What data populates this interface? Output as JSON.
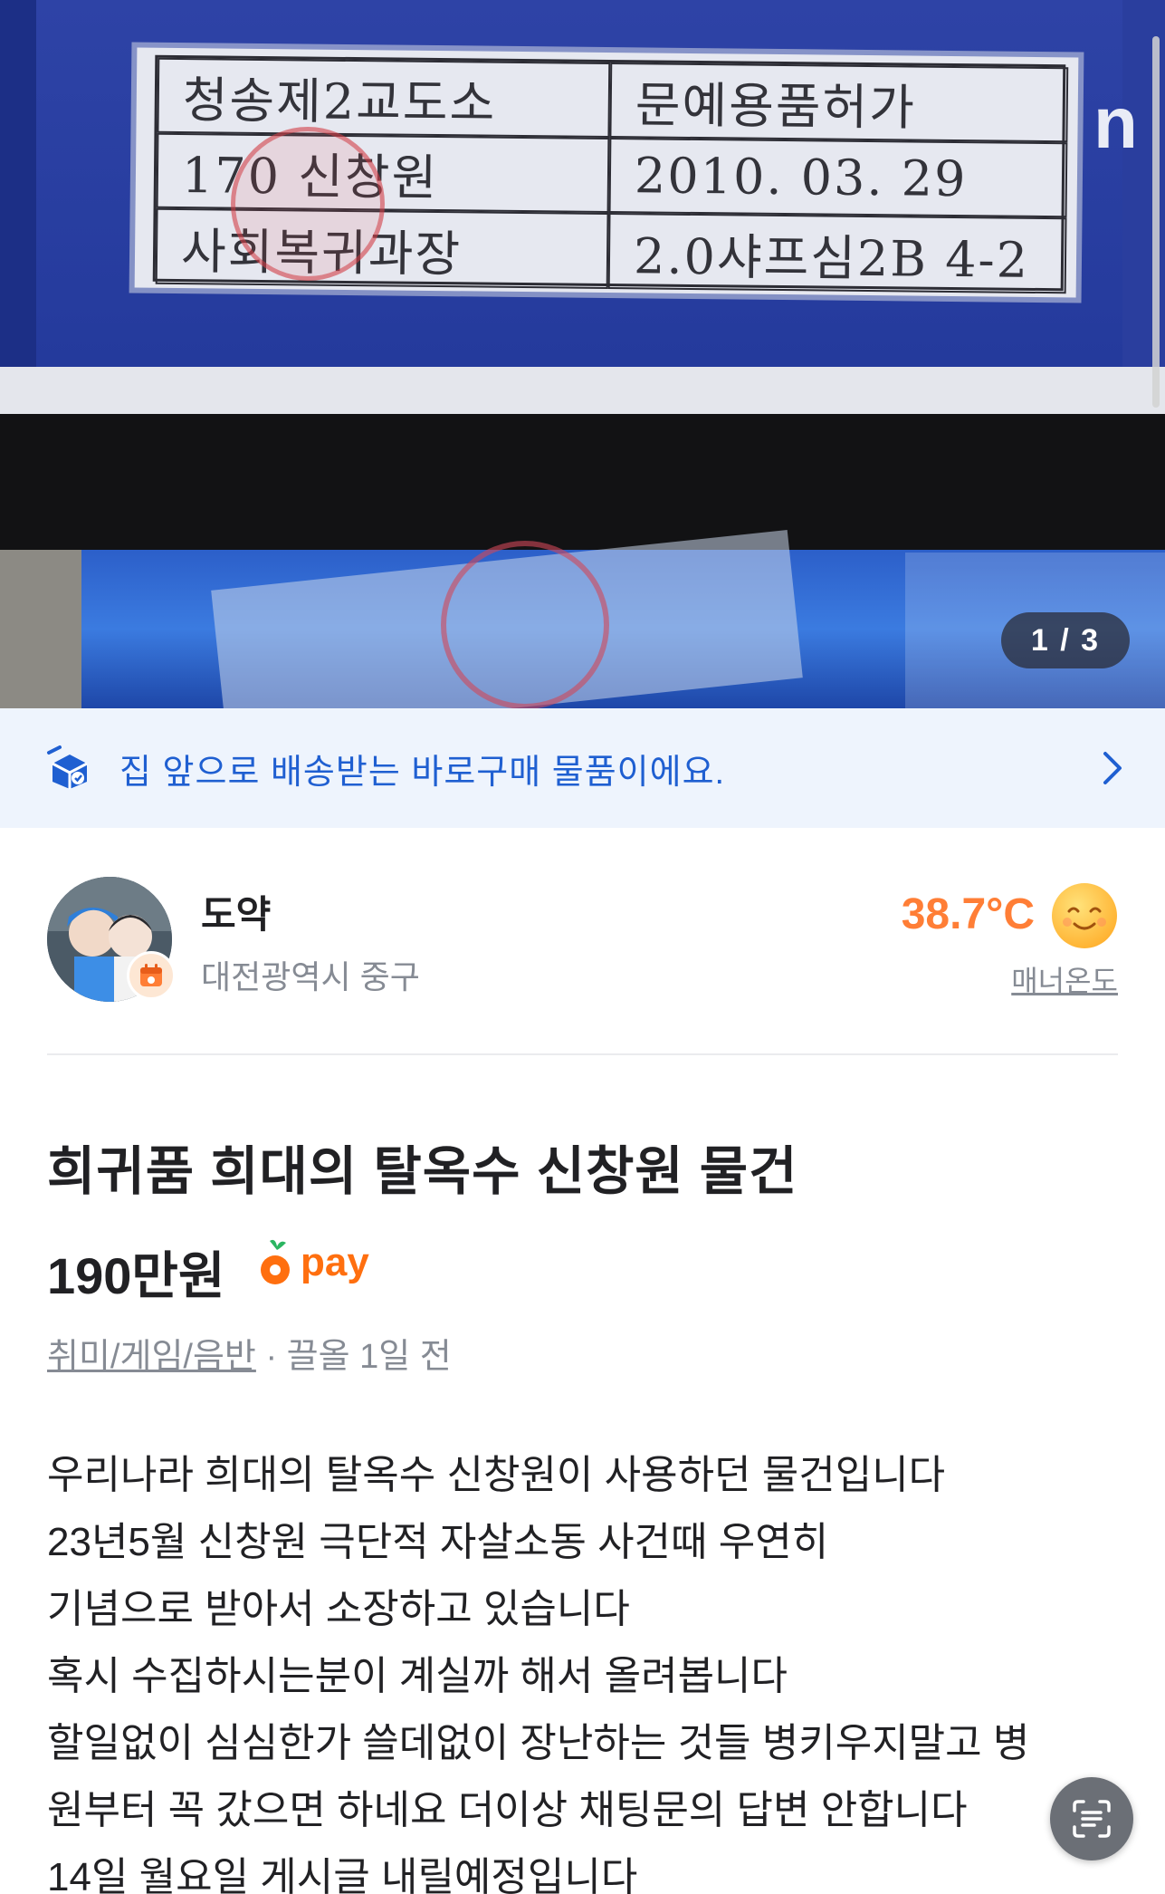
{
  "photo": {
    "label_rows": [
      [
        "청송제2교도소",
        "문예용품허가"
      ],
      [
        "170 신창원",
        "2010. 03. 29"
      ],
      [
        "사회복귀과장",
        "2.0샤프심2B 4-2"
      ]
    ],
    "edge_letter": "n",
    "counter": "1 / 3"
  },
  "banner": {
    "text": "집 앞으로 배송받는 바로구매 물품이에요.",
    "icon": "delivery-box-icon"
  },
  "seller": {
    "name": "도약",
    "location": "대전광역시 중구",
    "temperature": "38.7°C",
    "manner_label": "매너온도"
  },
  "listing": {
    "title": "희귀품 희대의 탈옥수 신창원 물건",
    "price": "190만원",
    "pay_label": "pay",
    "category": "취미/게임/음반",
    "separator": " · ",
    "bump_time": "끌올 1일 전",
    "description_lines": [
      "우리나라 희대의 탈옥수 신창원이 사용하던 물건입니다",
      "23년5월 신창원 극단적 자살소동 사건때 우연히",
      "기념으로 받아서 소장하고 있습니다",
      "혹시 수집하시는분이 계실까 해서 올려봅니다",
      "할일없이 심심한가 쓸데없이 장난하는 것들 병키우지말고 병",
      "원부터 꼭 갔으면 하네요 더이상 채팅문의 답변 안합니다",
      "14일 월요일 게시글 내릴예정입니다"
    ]
  },
  "colors": {
    "accent_orange": "#ff7e36",
    "banner_blue": "#1f5fd1",
    "banner_bg": "#eef4fd",
    "muted_gray": "#868b94"
  }
}
